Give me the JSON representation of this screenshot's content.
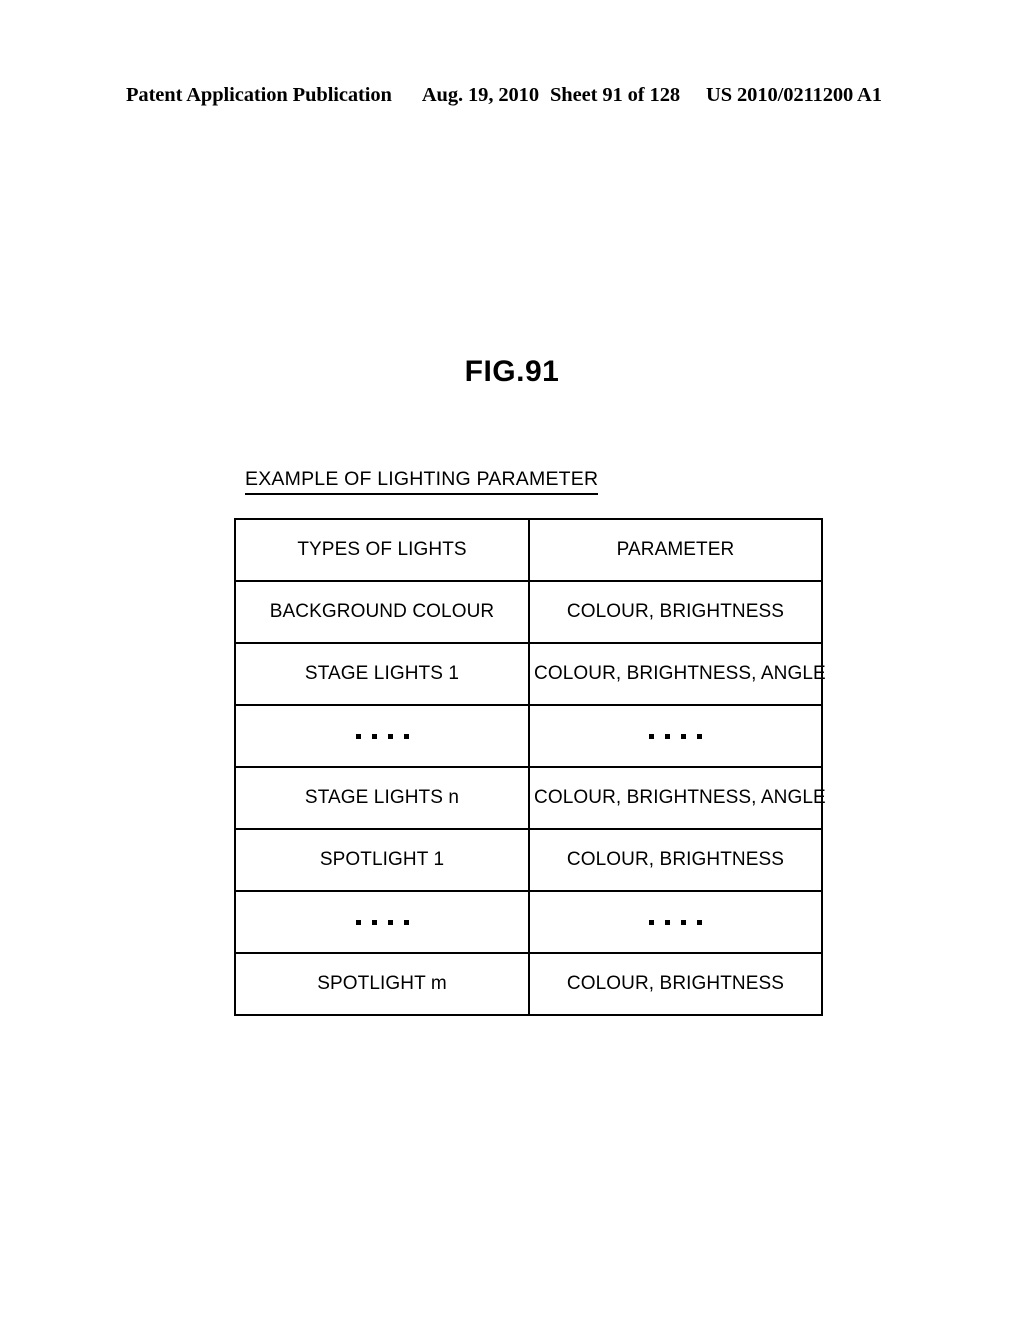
{
  "header": {
    "publication": "Patent Application Publication",
    "date": "Aug. 19, 2010",
    "sheet": "Sheet 91 of 128",
    "patent_number": "US 2010/0211200 A1"
  },
  "figure": {
    "label": "FIG.91",
    "caption": "EXAMPLE OF LIGHTING PARAMETER"
  },
  "table": {
    "columns": [
      "TYPES OF LIGHTS",
      "PARAMETER"
    ],
    "rows": [
      {
        "type": "text",
        "lights": "BACKGROUND COLOUR",
        "parameter": "COLOUR, BRIGHTNESS"
      },
      {
        "type": "text",
        "lights": "STAGE LIGHTS 1",
        "parameter": "COLOUR, BRIGHTNESS, ANGLE"
      },
      {
        "type": "ellipsis",
        "lights": "....",
        "parameter": "...."
      },
      {
        "type": "text",
        "lights": "STAGE LIGHTS n",
        "parameter": "COLOUR, BRIGHTNESS, ANGLE"
      },
      {
        "type": "text",
        "lights": "SPOTLIGHT 1",
        "parameter": "COLOUR, BRIGHTNESS"
      },
      {
        "type": "ellipsis",
        "lights": "....",
        "parameter": "...."
      },
      {
        "type": "text",
        "lights": "SPOTLIGHT m",
        "parameter": "COLOUR, BRIGHTNESS"
      }
    ]
  },
  "colors": {
    "ink": "#000000",
    "page": "#ffffff"
  }
}
